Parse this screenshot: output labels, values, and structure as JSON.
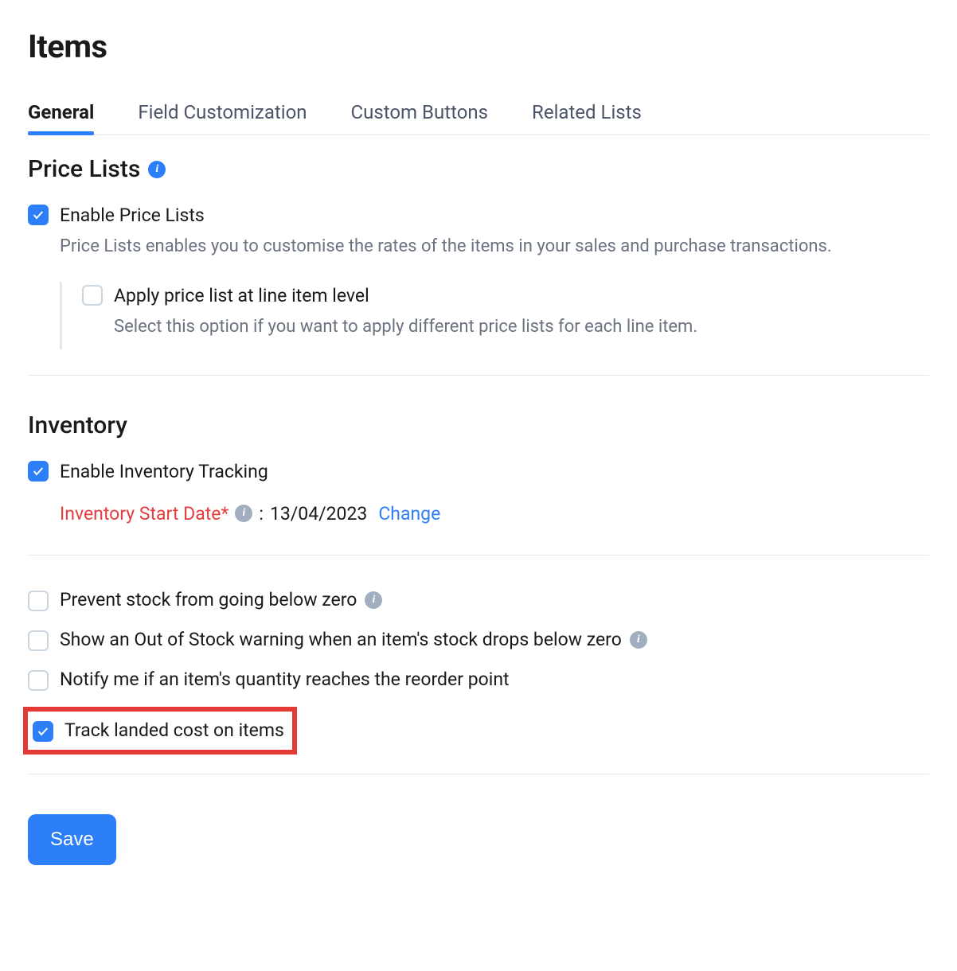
{
  "page": {
    "title": "Items"
  },
  "tabs": {
    "general": "General",
    "field_customization": "Field Customization",
    "custom_buttons": "Custom Buttons",
    "related_lists": "Related Lists"
  },
  "price_lists": {
    "heading": "Price Lists",
    "enable_label": "Enable Price Lists",
    "enable_desc": "Price Lists enables you to customise the rates of the items in your sales and purchase transactions.",
    "line_item_label": "Apply price list at line item level",
    "line_item_desc": "Select this option if you want to apply different price lists for each line item."
  },
  "inventory": {
    "heading": "Inventory",
    "enable_label": "Enable Inventory Tracking",
    "start_date_label": "Inventory Start Date*",
    "start_date_value": "13/04/2023",
    "change_link": "Change",
    "prevent_below_zero": "Prevent stock from going below zero",
    "out_of_stock_warning": "Show an Out of Stock warning when an item's stock drops below zero",
    "reorder_notify": "Notify me if an item's quantity reaches the reorder point",
    "track_landed_cost": "Track landed cost on items"
  },
  "buttons": {
    "save": "Save"
  }
}
